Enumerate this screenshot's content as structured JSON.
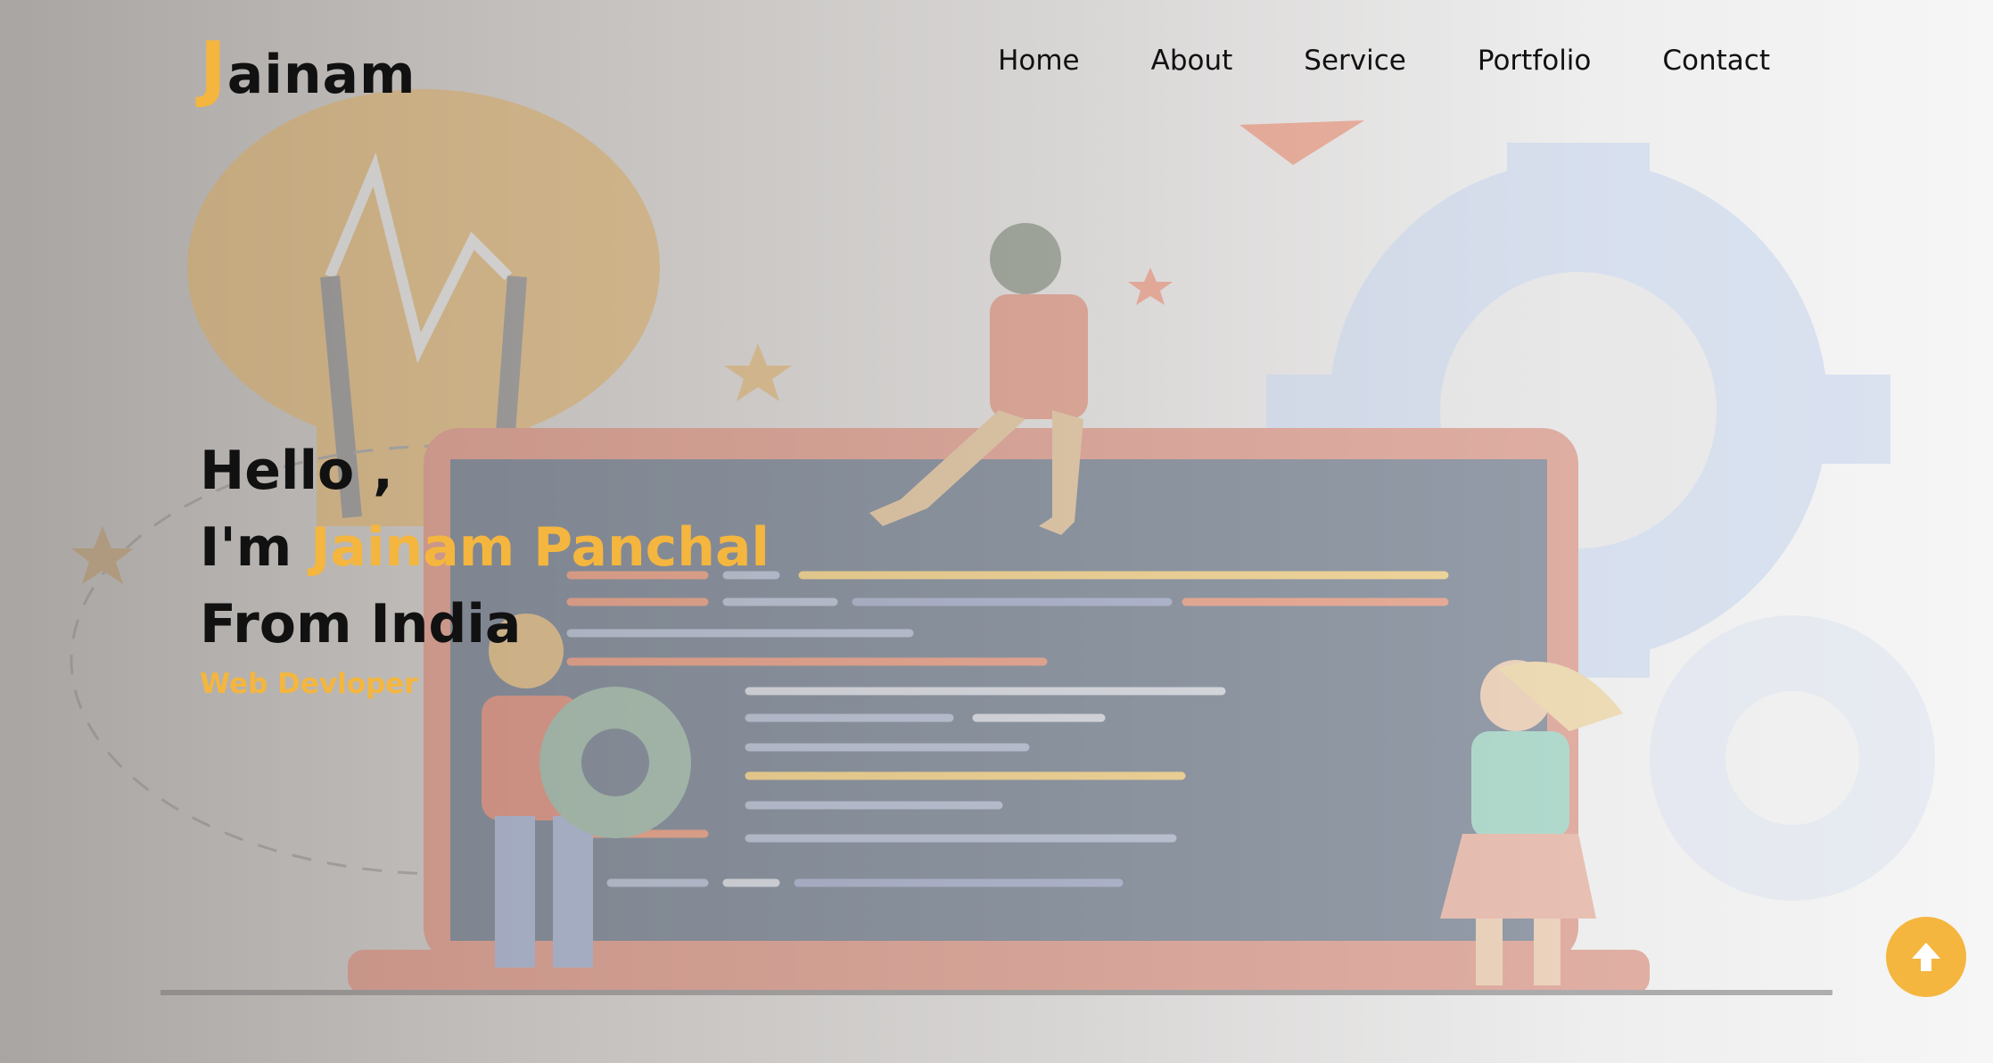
{
  "brand": {
    "logo_initial": "J",
    "logo_rest": "ainam"
  },
  "nav": {
    "items": [
      "Home",
      "About",
      "Service",
      "Portfolio",
      "Contact"
    ]
  },
  "hero": {
    "greeting": "Hello ,",
    "intro_prefix": "I'm ",
    "name": "Jainam Panchal",
    "location": "From India",
    "role": "Web Devloper"
  },
  "colors": {
    "accent": "#f4b63e",
    "text": "#111111"
  },
  "icons": {
    "scroll_top": "arrow-up-icon"
  }
}
